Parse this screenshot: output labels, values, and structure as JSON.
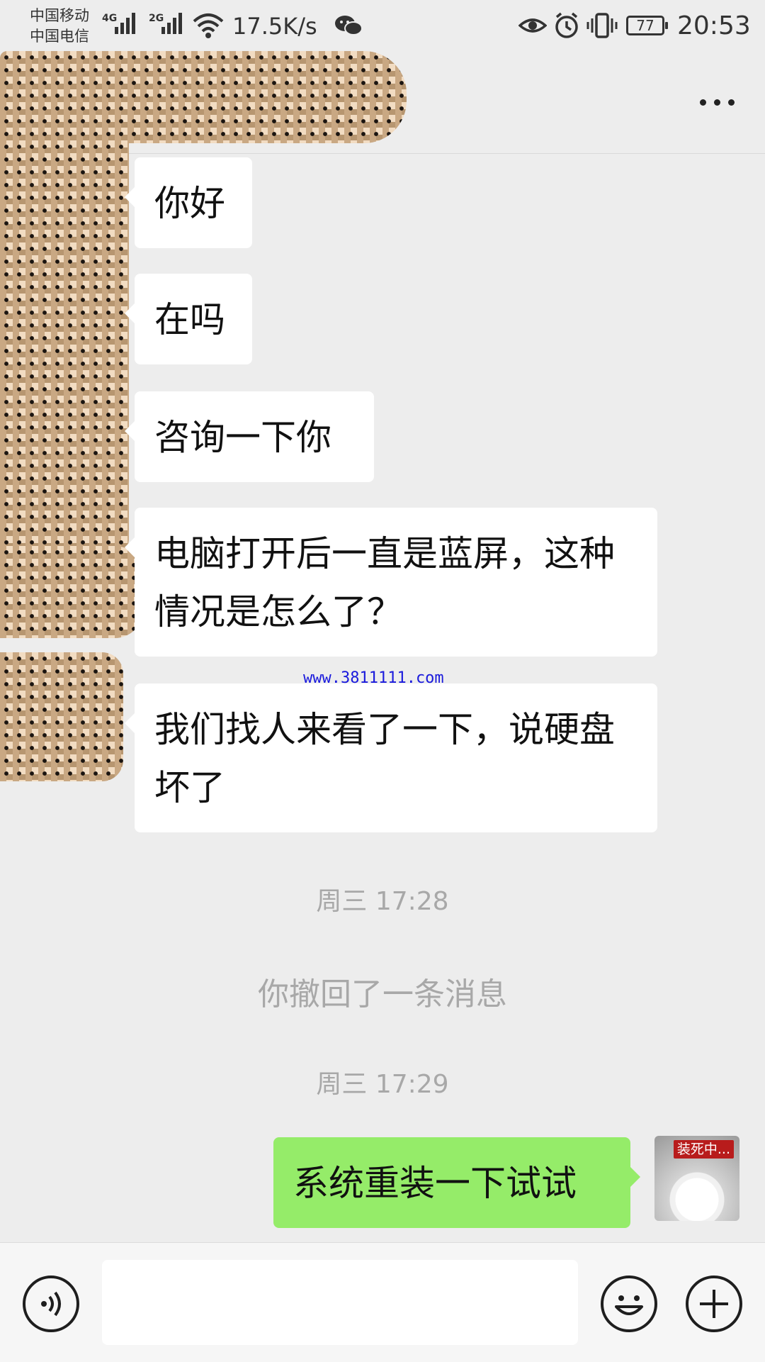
{
  "status_bar": {
    "carrier_1": "中国移动",
    "carrier_2": "中国电信",
    "net_1": "4G",
    "net_2": "2G",
    "speed": "17.5K/s",
    "battery": "77",
    "time": "20:53"
  },
  "header": {
    "more_icon": "more-dots-icon"
  },
  "messages": [
    {
      "sender": "contact",
      "text": "你好"
    },
    {
      "sender": "contact",
      "text": "在吗"
    },
    {
      "sender": "contact",
      "text": "咨询一下你"
    },
    {
      "sender": "contact",
      "text": "电脑打开后一直是蓝屏，这种情况是怎么了？"
    },
    {
      "sender": "contact",
      "text": "我们找人来看了一下，说硬盘坏了"
    },
    {
      "sender": "me",
      "text": "系统重装一下试试"
    }
  ],
  "timestamps": [
    "周三 17:28",
    "周三 17:29"
  ],
  "recall_notice": "你撤回了一条消息",
  "watermark": "www.3811111.com",
  "avatar_sign": "装死中...",
  "input_bar": {
    "voice_icon": "voice-icon",
    "emoji_icon": "emoji-icon",
    "plus_icon": "plus-icon",
    "placeholder": ""
  },
  "colors": {
    "background": "#ededed",
    "contact_bubble": "#ffffff",
    "my_bubble": "#95ec69",
    "system_text": "#a8a8a8",
    "watermark": "#1a1adc"
  }
}
